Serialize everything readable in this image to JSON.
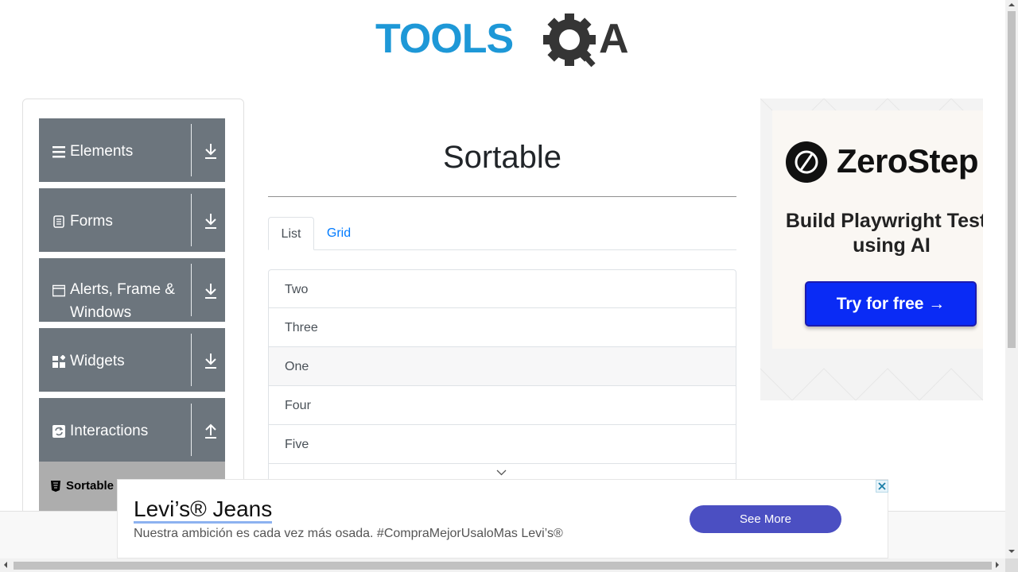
{
  "logo": {
    "text_left": "TOOLS",
    "text_right": "A",
    "colors": {
      "blue": "#1e98d7",
      "dark": "#353535"
    }
  },
  "sidebar": {
    "groups": [
      {
        "label": "Elements",
        "icon": "hamburger-icon",
        "arrow": "download-arrow-icon"
      },
      {
        "label": "Forms",
        "icon": "document-icon",
        "arrow": "download-arrow-icon"
      },
      {
        "label": "Alerts, Frame & Windows",
        "icon": "window-icon",
        "arrow": "download-arrow-icon"
      },
      {
        "label": "Widgets",
        "icon": "widgets-icon",
        "arrow": "download-arrow-icon"
      },
      {
        "label": "Interactions",
        "icon": "refresh-icon",
        "arrow": "upload-arrow-icon"
      }
    ],
    "submenu_item": {
      "label": "Sortable",
      "icon": "html5-icon"
    }
  },
  "main": {
    "title": "Sortable",
    "tabs": [
      {
        "label": "List",
        "active": true
      },
      {
        "label": "Grid",
        "active": false
      }
    ],
    "list_items": [
      "Two",
      "Three",
      "One",
      "Four",
      "Five"
    ]
  },
  "right_ad": {
    "brand": "ZeroStep",
    "tagline": "Build Playwright Tests using AI",
    "button": "Try for free →"
  },
  "bottom_ad": {
    "title": "Levi’s® Jeans",
    "subtitle": "Nuestra ambición es cada vez más osada. #CompraMejorUsaloMas Levi’s®",
    "button": "See More"
  },
  "colors": {
    "sidebar_bg": "#6c757d",
    "accent": "#007bff",
    "cta": "#0a2bf5",
    "ad_button": "#4b4fc2"
  }
}
